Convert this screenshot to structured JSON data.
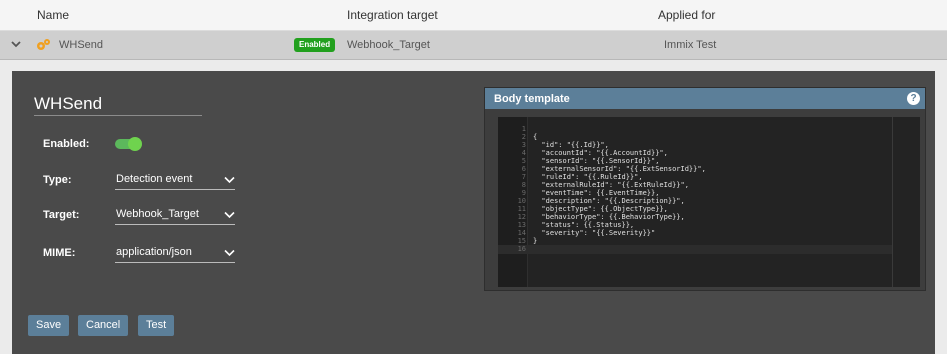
{
  "header": {
    "col_name": "Name",
    "col_target": "Integration target",
    "col_applied": "Applied for"
  },
  "row": {
    "name": "WHSend",
    "badge": "Enabled",
    "target": "Webhook_Target",
    "applied_for": "Immix Test",
    "icons": {
      "expand": "chevron-down-icon",
      "type": "gears-icon"
    },
    "badge_color": "#22a01e"
  },
  "form": {
    "name_value": "WHSend",
    "enabled_label": "Enabled:",
    "enabled": true,
    "type_label": "Type:",
    "type_value": "Detection event",
    "target_label": "Target:",
    "target_value": "Webhook_Target",
    "mime_label": "MIME:",
    "mime_value": "application/json",
    "buttons": {
      "save": "Save",
      "cancel": "Cancel",
      "test": "Test"
    }
  },
  "body_template": {
    "title": "Body template",
    "help": "?",
    "lines": [
      "",
      "{",
      "  \"id\": \"{{.Id}}\",",
      "  \"accountId\": \"{{.AccountId}}\",",
      "  \"sensorId\": \"{{.SensorId}}\",",
      "  \"externalSensorId\": \"{{.ExtSensorId}}\",",
      "  \"ruleId\": \"{{.RuleId}}\",",
      "  \"externalRuleId\": \"{{.ExtRuleId}}\",",
      "  \"eventTime\": {{.EventTime}},",
      "  \"description\": \"{{.Description}}\",",
      "  \"objectType\": {{.ObjectType}},",
      "  \"behaviorType\": {{.BehaviorType}},",
      "  \"status\": {{.Status}},",
      "  \"severity\": \"{{.Severity}}\"",
      "}",
      ""
    ],
    "line_numbers": [
      "1",
      "2",
      "3",
      "4",
      "5",
      "6",
      "7",
      "8",
      "9",
      "10",
      "11",
      "12",
      "13",
      "14",
      "15",
      "16"
    ]
  },
  "colors": {
    "accent": "#5c7f99",
    "panel_bg": "#4a4a4a",
    "toggle_on": "#6fd34e"
  }
}
